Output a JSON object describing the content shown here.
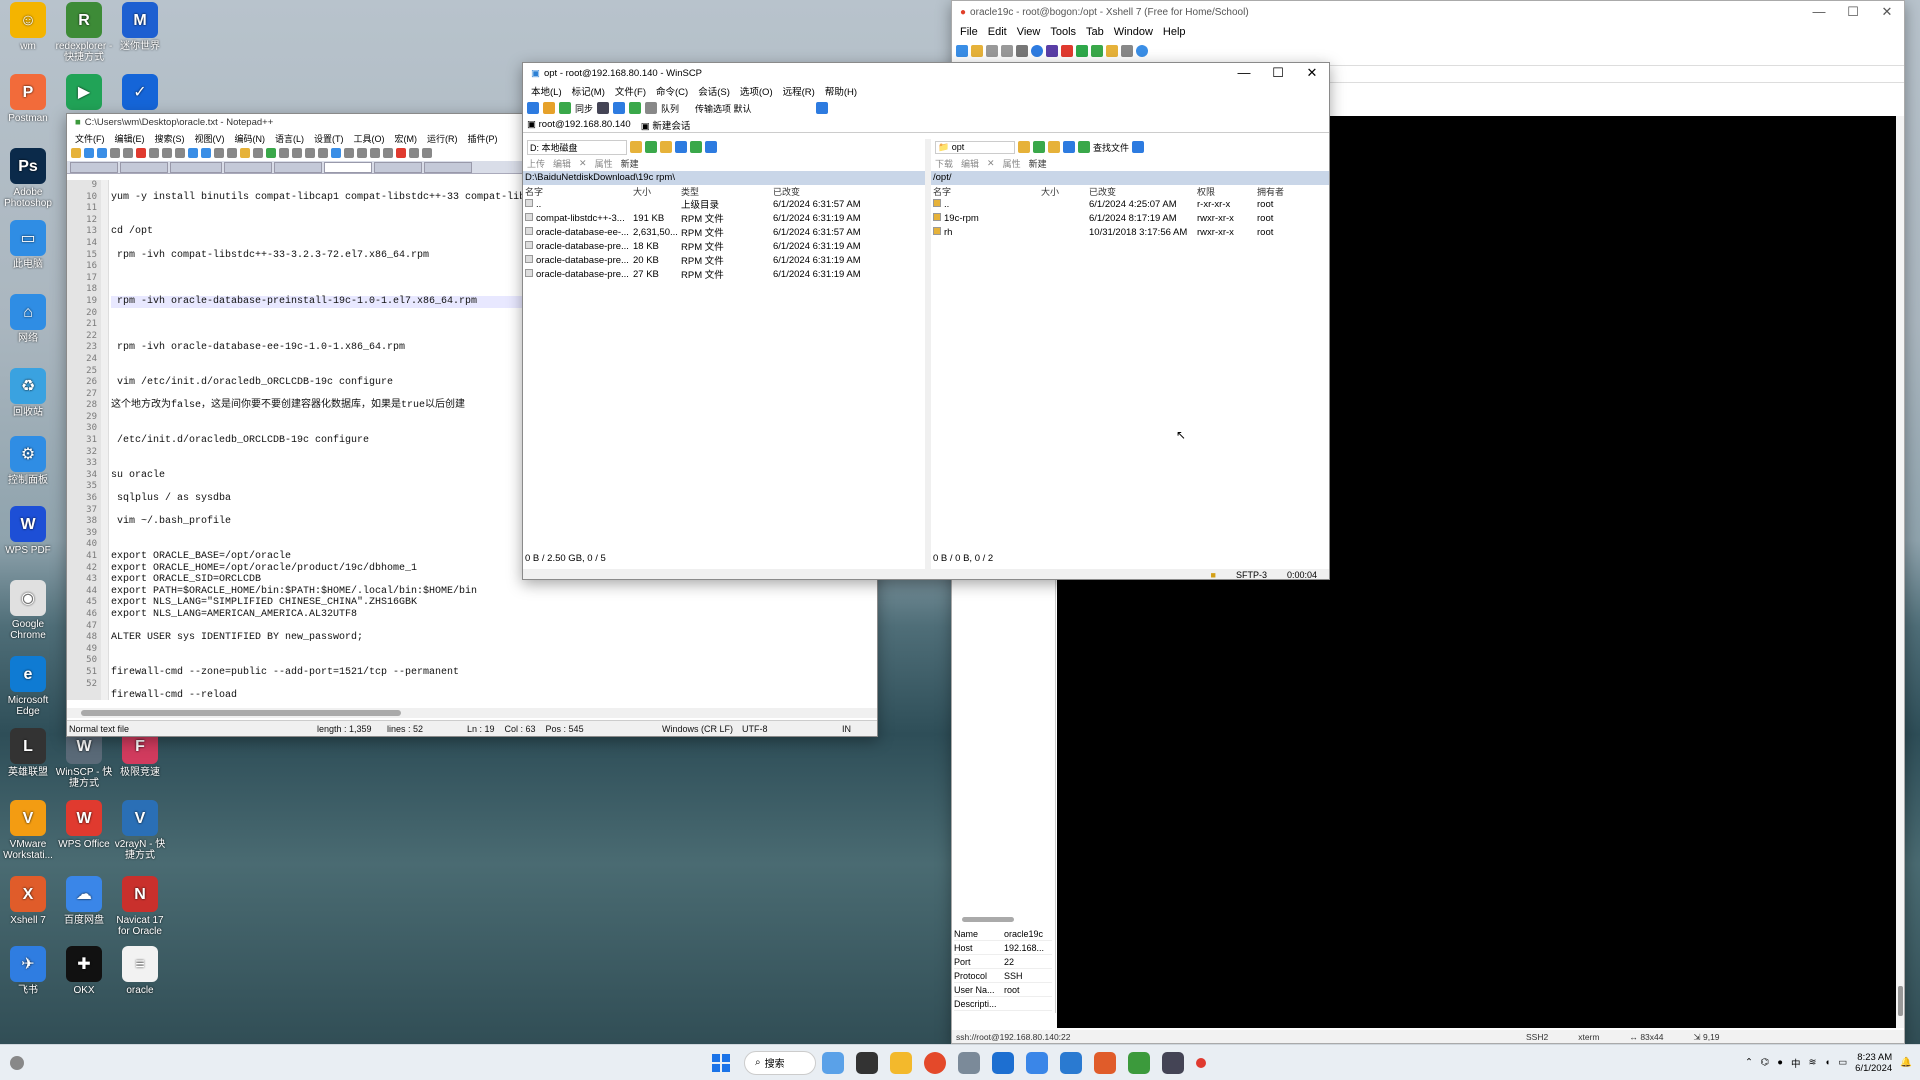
{
  "desktop": {
    "icons": [
      {
        "label": "wm",
        "color": "#f4b400",
        "glyph": "☺"
      },
      {
        "label": "redexplorer - 快捷方式",
        "color": "#3d8b37",
        "glyph": "R"
      },
      {
        "label": "迷你世界",
        "color": "#1d5fd1",
        "glyph": "M"
      },
      {
        "label": "Postman",
        "color": "#f26b3a",
        "glyph": "P"
      },
      {
        "label": "",
        "color": "#21a357",
        "glyph": "▶"
      },
      {
        "label": "",
        "color": "#1565d8",
        "glyph": "✓"
      },
      {
        "label": "Adobe Photoshop",
        "color": "#0b2a4a",
        "glyph": "Ps"
      },
      {
        "label": "此电脑",
        "color": "#2f8de4",
        "glyph": "▭"
      },
      {
        "label": "网络",
        "color": "#2f8de4",
        "glyph": "⌂"
      },
      {
        "label": "回收站",
        "color": "#3aa2e0",
        "glyph": "♻"
      },
      {
        "label": "控制面板",
        "color": "#2f8de4",
        "glyph": "⚙"
      },
      {
        "label": "WPS PDF",
        "color": "#1d4fd6",
        "glyph": "W"
      },
      {
        "label": "Google Chrome",
        "color": "#e0e0e0",
        "glyph": "◉"
      },
      {
        "label": "Microsoft Edge",
        "color": "#0f7bd3",
        "glyph": "e"
      },
      {
        "label": "英雄联盟",
        "color": "#333",
        "glyph": "L"
      },
      {
        "label": "WinSCP - 快捷方式",
        "color": "#5a6a78",
        "glyph": "W"
      },
      {
        "label": "极限竞速",
        "color": "#d23b5e",
        "glyph": "F"
      },
      {
        "label": "VMware Workstati...",
        "color": "#f39c12",
        "glyph": "V"
      },
      {
        "label": "WPS Office",
        "color": "#e03a2f",
        "glyph": "W"
      },
      {
        "label": "v2rayN - 快捷方式",
        "color": "#2a6fb6",
        "glyph": "V"
      },
      {
        "label": "Xshell 7",
        "color": "#e05c2a",
        "glyph": "X"
      },
      {
        "label": "百度网盘",
        "color": "#3a86e8",
        "glyph": "☁"
      },
      {
        "label": "Navicat 17 for Oracle",
        "color": "#c9302c",
        "glyph": "N"
      },
      {
        "label": "飞书",
        "color": "#2f7de1",
        "glyph": "✈"
      },
      {
        "label": "OKX",
        "color": "#111",
        "glyph": "✚"
      },
      {
        "label": "oracle",
        "color": "#f2f2f2",
        "glyph": "≡"
      }
    ]
  },
  "notepad": {
    "title": "C:\\Users\\wm\\Desktop\\oracle.txt - Notepad++",
    "menus": [
      "文件(F)",
      "编辑(E)",
      "搜索(S)",
      "视图(V)",
      "编码(N)",
      "语言(L)",
      "设置(T)",
      "工具(O)",
      "宏(M)",
      "运行(R)",
      "插件(P)"
    ],
    "line_numbers": [
      "9",
      "10",
      "11",
      "12",
      "13",
      "14",
      "15",
      "16",
      "17",
      "18",
      "19",
      "20",
      "21",
      "22",
      "23",
      "24",
      "25",
      "26",
      "27",
      "28",
      "29",
      "30",
      "31",
      "32",
      "33",
      "34",
      "35",
      "36",
      "37",
      "38",
      "39",
      "40",
      "41",
      "42",
      "43",
      "44",
      "45",
      "46",
      "47",
      "48",
      "49",
      "50",
      "51",
      "52"
    ],
    "lines": [
      "",
      "yum -y install binutils compat-libcap1 compat-libstdc++-33 compat-lib",
      "",
      "",
      "cd /opt",
      "",
      " rpm -ivh compat-libstdc++-33-3.2.3-72.el7.x86_64.rpm",
      "",
      "",
      "",
      " rpm -ivh oracle-database-preinstall-19c-1.0-1.el7.x86_64.rpm",
      "",
      "",
      "",
      " rpm -ivh oracle-database-ee-19c-1.0-1.x86_64.rpm",
      "",
      "",
      " vim /etc/init.d/oracledb_ORCLCDB-19c configure",
      "",
      "这个地方改为false，这是间你要不要创建容器化数据库，如果是true以后创建",
      "",
      "",
      " /etc/init.d/oracledb_ORCLCDB-19c configure",
      "",
      "",
      "su oracle",
      "",
      " sqlplus / as sysdba",
      "",
      " vim ~/.bash_profile",
      "",
      "",
      "export ORACLE_BASE=/opt/oracle",
      "export ORACLE_HOME=/opt/oracle/product/19c/dbhome_1",
      "export ORACLE_SID=ORCLCDB",
      "export PATH=$ORACLE_HOME/bin:$PATH:$HOME/.local/bin:$HOME/bin",
      "export NLS_LANG=\"SIMPLIFIED CHINESE_CHINA\".ZHS16GBK",
      "export NLS_LANG=AMERICAN_AMERICA.AL32UTF8",
      "",
      "ALTER USER sys IDENTIFIED BY new_password;",
      "",
      "",
      "firewall-cmd --zone=public --add-port=1521/tcp --permanent",
      "",
      "firewall-cmd --reload"
    ],
    "status": {
      "type": "Normal text file",
      "length": "length : 1,359",
      "lines": "lines : 52",
      "pos": "Ln : 19    Col : 63    Pos : 545",
      "eol": "Windows (CR LF)",
      "enc": "UTF-8",
      "mode": "IN"
    }
  },
  "winscp": {
    "title": "opt - root@192.168.80.140 - WinSCP",
    "menus": [
      "本地(L)",
      "标记(M)",
      "文件(F)",
      "命令(C)",
      "会话(S)",
      "选项(O)",
      "远程(R)",
      "帮助(H)"
    ],
    "toolbar": {
      "queue": "队列",
      "transfer": "传输选项 默认"
    },
    "session_tab": "root@192.168.80.140",
    "new_session": "新建会话",
    "left": {
      "drive": "D: 本地磁盘",
      "path": "D:\\BaiduNetdiskDownload\\19c rpm\\",
      "headers": [
        "名字",
        "大小",
        "类型",
        "已改变"
      ],
      "rows": [
        {
          "name": "..",
          "size": "",
          "type": "上级目录",
          "date": "6/1/2024  6:31:57 AM"
        },
        {
          "name": "compat-libstdc++-3...",
          "size": "191 KB",
          "type": "RPM 文件",
          "date": "6/1/2024  6:31:19 AM"
        },
        {
          "name": "oracle-database-ee-...",
          "size": "2,631,50...",
          "type": "RPM 文件",
          "date": "6/1/2024  6:31:57 AM"
        },
        {
          "name": "oracle-database-pre...",
          "size": "18 KB",
          "type": "RPM 文件",
          "date": "6/1/2024  6:31:19 AM"
        },
        {
          "name": "oracle-database-pre...",
          "size": "20 KB",
          "type": "RPM 文件",
          "date": "6/1/2024  6:31:19 AM"
        },
        {
          "name": "oracle-database-pre...",
          "size": "27 KB",
          "type": "RPM 文件",
          "date": "6/1/2024  6:31:19 AM"
        }
      ],
      "status": "0 B / 2.50 GB,  0 / 5"
    },
    "right": {
      "dir": "opt",
      "find": "查找文件",
      "path": "/opt/",
      "headers": [
        "名字",
        "大小",
        "已改变",
        "权限",
        "拥有者"
      ],
      "rows": [
        {
          "name": "..",
          "size": "",
          "date": "6/1/2024  4:25:07 AM",
          "perm": "r-xr-xr-x",
          "owner": "root"
        },
        {
          "name": "19c-rpm",
          "size": "",
          "date": "6/1/2024  8:17:19 AM",
          "perm": "rwxr-xr-x",
          "owner": "root"
        },
        {
          "name": "rh",
          "size": "",
          "date": "10/31/2018  3:17:56 AM",
          "perm": "rwxr-xr-x",
          "owner": "root"
        }
      ],
      "status": "0 B / 0 B,  0 / 2"
    },
    "bottom": {
      "proto": "SFTP-3",
      "time": "0:00:04"
    },
    "actions": {
      "upload": "上传",
      "edit": "编辑",
      "properties": "属性",
      "new": "新建",
      "download": "下载"
    }
  },
  "xshell": {
    "title": "oracle19c - root@bogon:/opt - Xshell 7 (Free for Home/School)",
    "menus": [
      "File",
      "Edit",
      "View",
      "Tools",
      "Tab",
      "Window",
      "Help"
    ],
    "info": [
      {
        "k": "Name",
        "v": "oracle19c"
      },
      {
        "k": "Host",
        "v": "192.168..."
      },
      {
        "k": "Port",
        "v": "22"
      },
      {
        "k": "Protocol",
        "v": "SSH"
      },
      {
        "k": "User Na...",
        "v": "root"
      },
      {
        "k": "Descripti...",
        "v": ""
      }
    ],
    "status": {
      "addr": "ssh://root@192.168.80.140:22",
      "proto": "SSH2",
      "term": "xterm",
      "size": "↔ 83x44",
      "pos": "⇲ 9,19"
    }
  },
  "taskbar": {
    "search": "搜索",
    "time": "8:23 AM",
    "date": "6/1/2024",
    "ime": "中"
  }
}
